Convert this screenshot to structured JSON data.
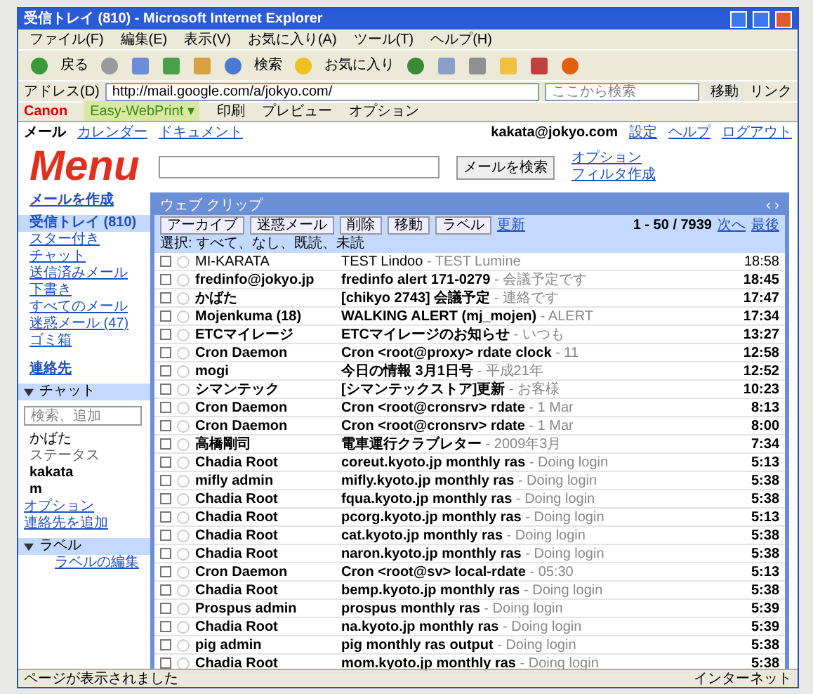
{
  "window": {
    "title": "受信トレイ (810) - Microsoft Internet Explorer"
  },
  "menu": [
    "ファイル(F)",
    "編集(E)",
    "表示(V)",
    "お気に入り(A)",
    "ツール(T)",
    "ヘルプ(H)"
  ],
  "toolbar": {
    "back": "戻る",
    "search": "検索",
    "favorites": "お気に入り"
  },
  "address": {
    "label": "アドレス(D)",
    "value": "http://mail.google.com/a/jokyo.com/",
    "search_placeholder": "ここから検索",
    "go": "移動",
    "links": "リンク"
  },
  "links_bar": {
    "brand": "Canon",
    "product": "Easy-WebPrint ▾",
    "items": [
      "印刷",
      "プレビュー",
      "オプション"
    ]
  },
  "top_nav": {
    "left": [
      "メール",
      "カレンダー",
      "ドキュメント"
    ],
    "account": "kakata@jokyo.com",
    "right": [
      "設定",
      "ヘルプ",
      "ログアウト"
    ]
  },
  "logo": "Menu",
  "search": {
    "button": "メールを検索",
    "options": [
      "オプション",
      "フィルタ作成"
    ]
  },
  "sidebar": {
    "compose": "メールを作成",
    "items": [
      {
        "label": "受信トレイ (810)",
        "selected": true
      },
      {
        "label": "スター付き",
        "selected": false
      },
      {
        "label": "チャット",
        "selected": false
      },
      {
        "label": "送信済みメール",
        "selected": false
      },
      {
        "label": "下書き",
        "selected": false
      },
      {
        "label": "すべてのメール",
        "selected": false
      },
      {
        "label": "迷惑メール (47)",
        "selected": false
      },
      {
        "label": "ゴミ箱",
        "selected": false
      }
    ],
    "contacts": "連絡先",
    "chat": {
      "title": "チャット",
      "expanded": true,
      "search_placeholder": "検索、追加",
      "user": "かばた",
      "status": "ステータス",
      "lines": [
        "kakata",
        "m"
      ],
      "options": "オプション",
      "add": "連絡先を追加"
    },
    "labels": {
      "title": "ラベル",
      "expanded": true,
      "edit": "ラベルの編集"
    }
  },
  "panel": {
    "header": "ウェブ クリップ",
    "header_right": "‹ ›",
    "actions": [
      "アーカイブ",
      "迷惑メール",
      "削除",
      "移動",
      "ラベル"
    ],
    "refresh": "更新",
    "count": "1 - 50 / 7939",
    "next": "次へ",
    "last": "最後",
    "select": "選択: すべて、なし、既読、未読"
  },
  "emails": [
    {
      "sender": "MI-KARATA",
      "subject": "TEST Lindoo",
      "snippet": " - TEST Lumine",
      "time": "18:58",
      "checked": false,
      "starred": false,
      "unread": false
    },
    {
      "sender": "fredinfo@jokyo.jp",
      "subject": "fredinfo alert 171-0279",
      "snippet": " - 会議予定です",
      "time": "18:45",
      "checked": false,
      "starred": false,
      "unread": true
    },
    {
      "sender": "かばた",
      "subject": "[chikyo 2743] 会議予定",
      "snippet": " - 連絡です",
      "time": "17:47",
      "checked": false,
      "starred": false,
      "unread": true
    },
    {
      "sender": "Mojenkuma (18)",
      "subject": "WALKING ALERT (mj_mojen)",
      "snippet": " - ALERT",
      "time": "17:34",
      "checked": false,
      "starred": false,
      "unread": true
    },
    {
      "sender": "ETCマイレージ",
      "subject": "ETCマイレージのお知らせ",
      "snippet": " - いつも",
      "time": "13:27",
      "checked": false,
      "starred": false,
      "unread": true
    },
    {
      "sender": "Cron Daemon",
      "subject": "Cron <root@proxy> rdate clock",
      "snippet": " - 11",
      "time": "12:58",
      "checked": false,
      "starred": false,
      "unread": true
    },
    {
      "sender": "mogi",
      "subject": "今日の情報 3月1日号",
      "snippet": " - 平成21年",
      "time": "12:52",
      "checked": false,
      "starred": false,
      "unread": true
    },
    {
      "sender": "シマンテック",
      "subject": "[シマンテックストア]更新",
      "snippet": " - お客様",
      "time": "10:23",
      "checked": false,
      "starred": false,
      "unread": true
    },
    {
      "sender": "Cron Daemon",
      "subject": "Cron <root@cronsrv> rdate",
      "snippet": " - 1 Mar",
      "time": "8:13",
      "checked": false,
      "starred": false,
      "unread": true
    },
    {
      "sender": "Cron Daemon",
      "subject": "Cron <root@cronsrv> rdate",
      "snippet": " - 1 Mar",
      "time": "8:00",
      "checked": false,
      "starred": false,
      "unread": true
    },
    {
      "sender": "高橋剛司",
      "subject": "電車運行クラブレター",
      "snippet": " - 2009年3月",
      "time": "7:34",
      "checked": false,
      "starred": false,
      "unread": true
    },
    {
      "sender": "Chadia Root",
      "subject": "coreut.kyoto.jp monthly ras",
      "snippet": " - Doing login",
      "time": "5:13",
      "checked": false,
      "starred": false,
      "unread": true
    },
    {
      "sender": "mifly admin",
      "subject": "mifly.kyoto.jp monthly ras",
      "snippet": " - Doing login",
      "time": "5:38",
      "checked": false,
      "starred": false,
      "unread": true
    },
    {
      "sender": "Chadia Root",
      "subject": "fqua.kyoto.jp monthly ras",
      "snippet": " - Doing login",
      "time": "5:38",
      "checked": false,
      "starred": false,
      "unread": true
    },
    {
      "sender": "Chadia Root",
      "subject": "pcorg.kyoto.jp monthly ras",
      "snippet": " - Doing login",
      "time": "5:13",
      "checked": false,
      "starred": false,
      "unread": true
    },
    {
      "sender": "Chadia Root",
      "subject": "cat.kyoto.jp monthly ras",
      "snippet": " - Doing login",
      "time": "5:38",
      "checked": false,
      "starred": false,
      "unread": true
    },
    {
      "sender": "Chadia Root",
      "subject": "naron.kyoto.jp monthly ras",
      "snippet": " - Doing login",
      "time": "5:38",
      "checked": false,
      "starred": false,
      "unread": true
    },
    {
      "sender": "Cron Daemon",
      "subject": "Cron <root@sv> local-rdate",
      "snippet": " - 05:30",
      "time": "5:13",
      "checked": false,
      "starred": false,
      "unread": true
    },
    {
      "sender": "Chadia Root",
      "subject": "bemp.kyoto.jp monthly ras",
      "snippet": " - Doing login",
      "time": "5:38",
      "checked": false,
      "starred": false,
      "unread": true
    },
    {
      "sender": "Prospus admin",
      "subject": "prospus monthly ras",
      "snippet": " - Doing login",
      "time": "5:39",
      "checked": false,
      "starred": false,
      "unread": true
    },
    {
      "sender": "Chadia Root",
      "subject": "na.kyoto.jp monthly ras",
      "snippet": " - Doing login",
      "time": "5:39",
      "checked": false,
      "starred": false,
      "unread": true
    },
    {
      "sender": "pig admin",
      "subject": "pig monthly ras output",
      "snippet": " - Doing login",
      "time": "5:38",
      "checked": false,
      "starred": false,
      "unread": true
    },
    {
      "sender": "Chadia Root",
      "subject": "mom.kyoto.jp monthly ras",
      "snippet": " - Doing login",
      "time": "5:38",
      "checked": false,
      "starred": false,
      "unread": true
    }
  ],
  "status_bar": {
    "text": "ページが表示されました",
    "zone": "インターネット"
  }
}
